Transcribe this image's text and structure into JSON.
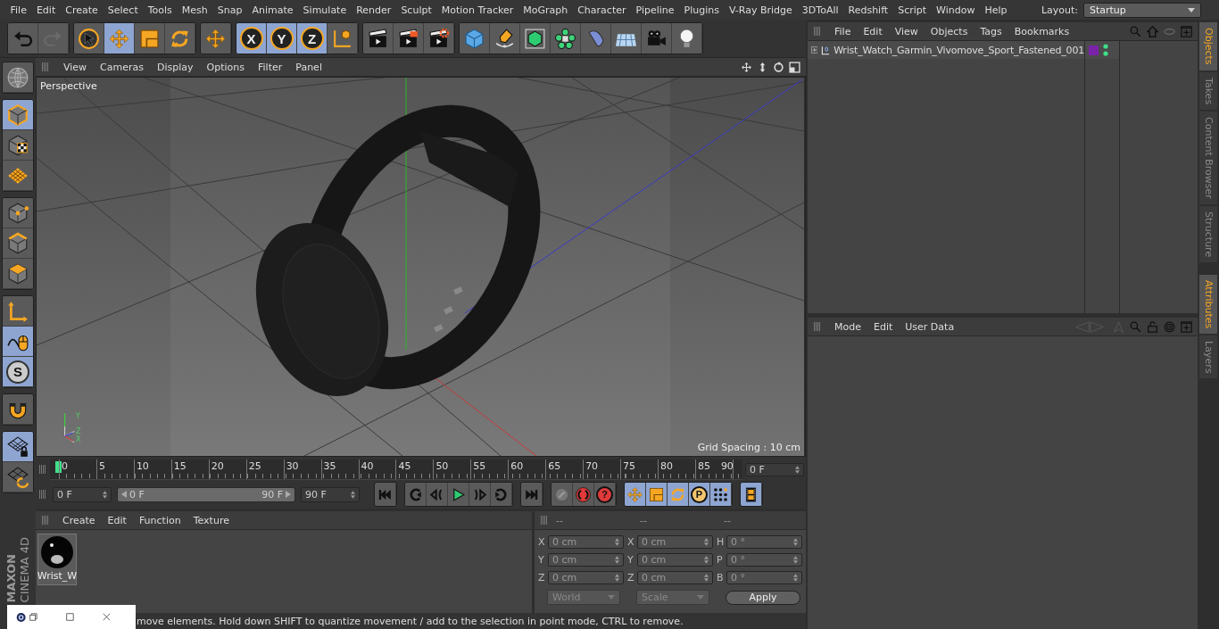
{
  "menu": [
    "File",
    "Edit",
    "Create",
    "Select",
    "Tools",
    "Mesh",
    "Snap",
    "Animate",
    "Simulate",
    "Render",
    "Sculpt",
    "Motion Tracker",
    "MoGraph",
    "Character",
    "Pipeline",
    "Plugins",
    "V-Ray Bridge",
    "3DToAll",
    "Redshift",
    "Script",
    "Window",
    "Help"
  ],
  "layout": {
    "label": "Layout:",
    "value": "Startup"
  },
  "toolbar": [
    [
      {
        "kind": "undo",
        "selected": false
      },
      {
        "kind": "redo",
        "selected": false
      }
    ],
    [
      {
        "kind": "select",
        "selected": false
      },
      {
        "kind": "move",
        "selected": true
      },
      {
        "kind": "scale",
        "selected": false
      },
      {
        "kind": "rotate",
        "selected": false
      }
    ],
    [
      {
        "kind": "transform",
        "selected": false
      }
    ],
    [
      {
        "kind": "letter",
        "label": "X",
        "selected": true
      },
      {
        "kind": "letter",
        "label": "Y",
        "selected": true
      },
      {
        "kind": "letter",
        "label": "Z",
        "selected": true
      },
      {
        "kind": "coord",
        "selected": false
      }
    ],
    [
      {
        "kind": "render-view",
        "selected": false
      },
      {
        "kind": "render-picture",
        "selected": false
      },
      {
        "kind": "render-settings",
        "selected": false
      }
    ],
    [
      {
        "kind": "cube",
        "selected": false
      },
      {
        "kind": "pen",
        "selected": false
      },
      {
        "kind": "subdivision",
        "selected": false
      },
      {
        "kind": "cloner",
        "selected": false
      },
      {
        "kind": "deformer",
        "selected": false
      },
      {
        "kind": "floor",
        "selected": false
      },
      {
        "kind": "camera",
        "selected": false
      },
      {
        "kind": "light",
        "selected": false
      }
    ]
  ],
  "tool_palette": [
    [
      {
        "kind": "make-editable",
        "selected": false
      }
    ],
    [
      {
        "kind": "model",
        "selected": true
      },
      {
        "kind": "texture",
        "selected": false
      },
      {
        "kind": "workplane",
        "selected": false
      }
    ],
    [
      {
        "kind": "points",
        "selected": false
      },
      {
        "kind": "edges",
        "selected": false
      },
      {
        "kind": "polygons",
        "selected": false
      }
    ],
    [
      {
        "kind": "axis",
        "selected": false
      },
      {
        "kind": "tweak",
        "selected": true
      },
      {
        "kind": "letter",
        "label": "S",
        "selected": true
      }
    ],
    [
      {
        "kind": "magnet",
        "selected": false
      }
    ],
    [
      {
        "kind": "grid-lock",
        "selected": true
      },
      {
        "kind": "grid-rotate",
        "selected": false
      }
    ]
  ],
  "logo": [
    "MAXON",
    "CINEMA 4D"
  ],
  "viewport": {
    "menu": [
      "View",
      "Cameras",
      "Display",
      "Options",
      "Filter",
      "Panel"
    ],
    "view_name": "Perspective",
    "grid_spacing": "Grid Spacing : 10 cm",
    "axis_labels": [
      "Y",
      "Z",
      "X"
    ]
  },
  "timeline": {
    "ticks": [
      "0",
      "5",
      "10",
      "15",
      "20",
      "25",
      "30",
      "35",
      "40",
      "45",
      "50",
      "55",
      "60",
      "65",
      "70",
      "75",
      "80",
      "85",
      "90"
    ],
    "current_frame": "0 F"
  },
  "transport": {
    "start": "0 F",
    "range_start": "0 F",
    "range_end": "90 F",
    "end": "90 F",
    "range_slider": {
      "level": 1
    },
    "buttons": [
      [
        {
          "kind": "first",
          "selected": false
        }
      ],
      [
        {
          "kind": "prev-key",
          "selected": false
        },
        {
          "kind": "prev-frame",
          "selected": false
        },
        {
          "kind": "play",
          "selected": false
        },
        {
          "kind": "next-frame",
          "selected": false
        },
        {
          "kind": "next-key",
          "selected": false
        }
      ],
      [
        {
          "kind": "last",
          "selected": false
        }
      ],
      [
        {
          "kind": "record",
          "selected": false
        },
        {
          "kind": "autokey",
          "selected": false
        },
        {
          "kind": "letter",
          "label": "?",
          "selected": false
        }
      ],
      [
        {
          "kind": "move",
          "selected": true
        },
        {
          "kind": "scale",
          "selected": true
        },
        {
          "kind": "rotate",
          "selected": true
        },
        {
          "kind": "letter",
          "label": "P",
          "selected": true
        },
        {
          "kind": "pla",
          "selected": true
        }
      ],
      [
        {
          "kind": "film",
          "selected": true
        }
      ]
    ]
  },
  "materials": {
    "menu": [
      "Create",
      "Edit",
      "Function",
      "Texture"
    ],
    "items": [
      {
        "name": "Wrist_W",
        "selected": false
      }
    ]
  },
  "coordinates": {
    "headers": [
      "--",
      "--",
      "--"
    ],
    "rows": [
      [
        {
          "axis": "X",
          "value": "0 cm"
        },
        {
          "axis": "X",
          "value": "0 cm"
        },
        {
          "axis": "H",
          "value": "0 °"
        }
      ],
      [
        {
          "axis": "Y",
          "value": "0 cm"
        },
        {
          "axis": "Y",
          "value": "0 cm"
        },
        {
          "axis": "P",
          "value": "0 °"
        }
      ],
      [
        {
          "axis": "Z",
          "value": "0 cm"
        },
        {
          "axis": "Z",
          "value": "0 cm"
        },
        {
          "axis": "B",
          "value": "0 °"
        }
      ]
    ],
    "dropdowns": [
      "World",
      "Scale"
    ],
    "apply": "Apply"
  },
  "status_bar": "move elements. Hold down SHIFT to quantize movement / add to the selection in point mode, CTRL to remove.",
  "objects": {
    "menu": [
      "File",
      "Edit",
      "View",
      "Objects",
      "Tags",
      "Bookmarks"
    ],
    "items": [
      {
        "name": "Wrist_Watch_Garmin_Vivomove_Sport_Fastened_001",
        "expanded": false,
        "selected": false,
        "color": "#7a22a8"
      }
    ]
  },
  "attributes": {
    "menu": [
      "Mode",
      "Edit",
      "User Data"
    ]
  },
  "side_tabs": [
    [
      {
        "label": "Objects",
        "selected": true
      },
      {
        "label": "Takes",
        "selected": false
      },
      {
        "label": "Content Browser",
        "selected": false
      },
      {
        "label": "Structure",
        "selected": false
      }
    ],
    [
      {
        "label": "Attributes",
        "selected": true
      },
      {
        "label": "Layers",
        "selected": false
      }
    ]
  ]
}
